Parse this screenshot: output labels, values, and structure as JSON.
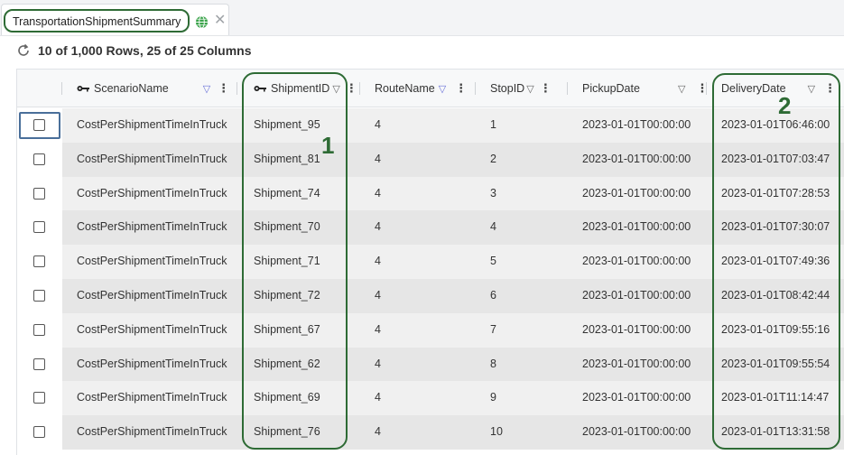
{
  "tab": {
    "title": "TransportationShipmentSummary",
    "globe_icon": "globe-icon",
    "close_icon": "close-icon"
  },
  "summary": {
    "text": "10 of 1,000 Rows, 25 of 25 Columns",
    "icon": "refresh-icon"
  },
  "columns": [
    {
      "label": "ScenarioName",
      "key": true
    },
    {
      "label": "ShipmentID",
      "key": true
    },
    {
      "label": "RouteName",
      "key": false
    },
    {
      "label": "StopID",
      "key": false
    },
    {
      "label": "PickupDate",
      "key": false
    },
    {
      "label": "DeliveryDate",
      "key": false
    }
  ],
  "rows": [
    [
      "CostPerShipmentTimeInTruck",
      "Shipment_95",
      "4",
      "1",
      "2023-01-01T00:00:00",
      "2023-01-01T06:46:00"
    ],
    [
      "CostPerShipmentTimeInTruck",
      "Shipment_81",
      "4",
      "2",
      "2023-01-01T00:00:00",
      "2023-01-01T07:03:47"
    ],
    [
      "CostPerShipmentTimeInTruck",
      "Shipment_74",
      "4",
      "3",
      "2023-01-01T00:00:00",
      "2023-01-01T07:28:53"
    ],
    [
      "CostPerShipmentTimeInTruck",
      "Shipment_70",
      "4",
      "4",
      "2023-01-01T00:00:00",
      "2023-01-01T07:30:07"
    ],
    [
      "CostPerShipmentTimeInTruck",
      "Shipment_71",
      "4",
      "5",
      "2023-01-01T00:00:00",
      "2023-01-01T07:49:36"
    ],
    [
      "CostPerShipmentTimeInTruck",
      "Shipment_72",
      "4",
      "6",
      "2023-01-01T00:00:00",
      "2023-01-01T08:42:44"
    ],
    [
      "CostPerShipmentTimeInTruck",
      "Shipment_67",
      "4",
      "7",
      "2023-01-01T00:00:00",
      "2023-01-01T09:55:16"
    ],
    [
      "CostPerShipmentTimeInTruck",
      "Shipment_62",
      "4",
      "8",
      "2023-01-01T00:00:00",
      "2023-01-01T09:55:54"
    ],
    [
      "CostPerShipmentTimeInTruck",
      "Shipment_69",
      "4",
      "9",
      "2023-01-01T00:00:00",
      "2023-01-01T11:14:47"
    ],
    [
      "CostPerShipmentTimeInTruck",
      "Shipment_76",
      "4",
      "10",
      "2023-01-01T00:00:00",
      "2023-01-01T13:31:58"
    ]
  ],
  "annotations": {
    "label_1": "1",
    "label_2": "2"
  },
  "colors": {
    "annotation": "#2e6b35",
    "filter_icon": "#6a72d8",
    "row_odd": "#f0f0f0",
    "row_even": "#e6e6e6"
  }
}
